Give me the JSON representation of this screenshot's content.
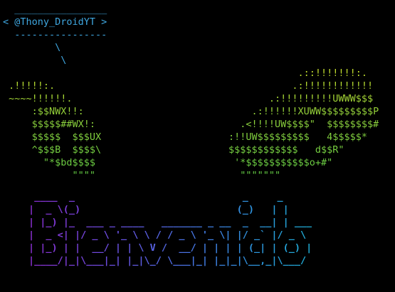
{
  "window": {
    "background": "#000000"
  },
  "speech_bubble": {
    "text": "  ________________\n< @Thony_DroidYT >\n  ----------------\n         \\\n          \\",
    "color": "#3fa7e0"
  },
  "ascii_art": {
    "text": "                                                   .::!!!!!!!:.\n .!!!!!:.                                         .:!!!!!!!!!!!!\n ~~~~!!!!!!.                                  .:!!!!!!!!!UWWW$$$\n     :$$NWX!!:                             .:!!!!!!XUWW$$$$$$$$$P\n     $$$$$##WX!:                         .<!!!!UW$$$$\"  $$$$$$$$#\n     $$$$$  $$$UX                      :!!UW$$$$$$$$$   4$$$$$*\n     ^$$$B  $$$$\\                      $$$$$$$$$$$$   d$$R\"\n       \"*$bd$$$$                        '*$$$$$$$$$$$o+#\"\n            \"\"\"\"                         \"\"\"\"\"\"\"",
    "colors": [
      "#c8e02c",
      "#8fd23c",
      "#5fcf46"
    ]
  },
  "banner": {
    "text": " ____  _                             _     _\n|  _ \\(_)                           (_)   | |\n| |_) |_  ___ _ ____   _______ _ __  _  __| | ___\n|  _ <| |/ _ \\ '_ \\ \\ / / _ \\ '_ \\| |/ _` |/ _ \\\n| |_) | |  __/ | | \\ V /  __/ | | | | (_| | (_) |\n|____/|_|\\___|_| |_|\\_/ \\___|_| |_|_|\\__,_|\\___/",
    "colors": [
      "#8a2fd0",
      "#6a4ee0",
      "#4a72e4",
      "#2f92de",
      "#1fb0d8"
    ]
  }
}
